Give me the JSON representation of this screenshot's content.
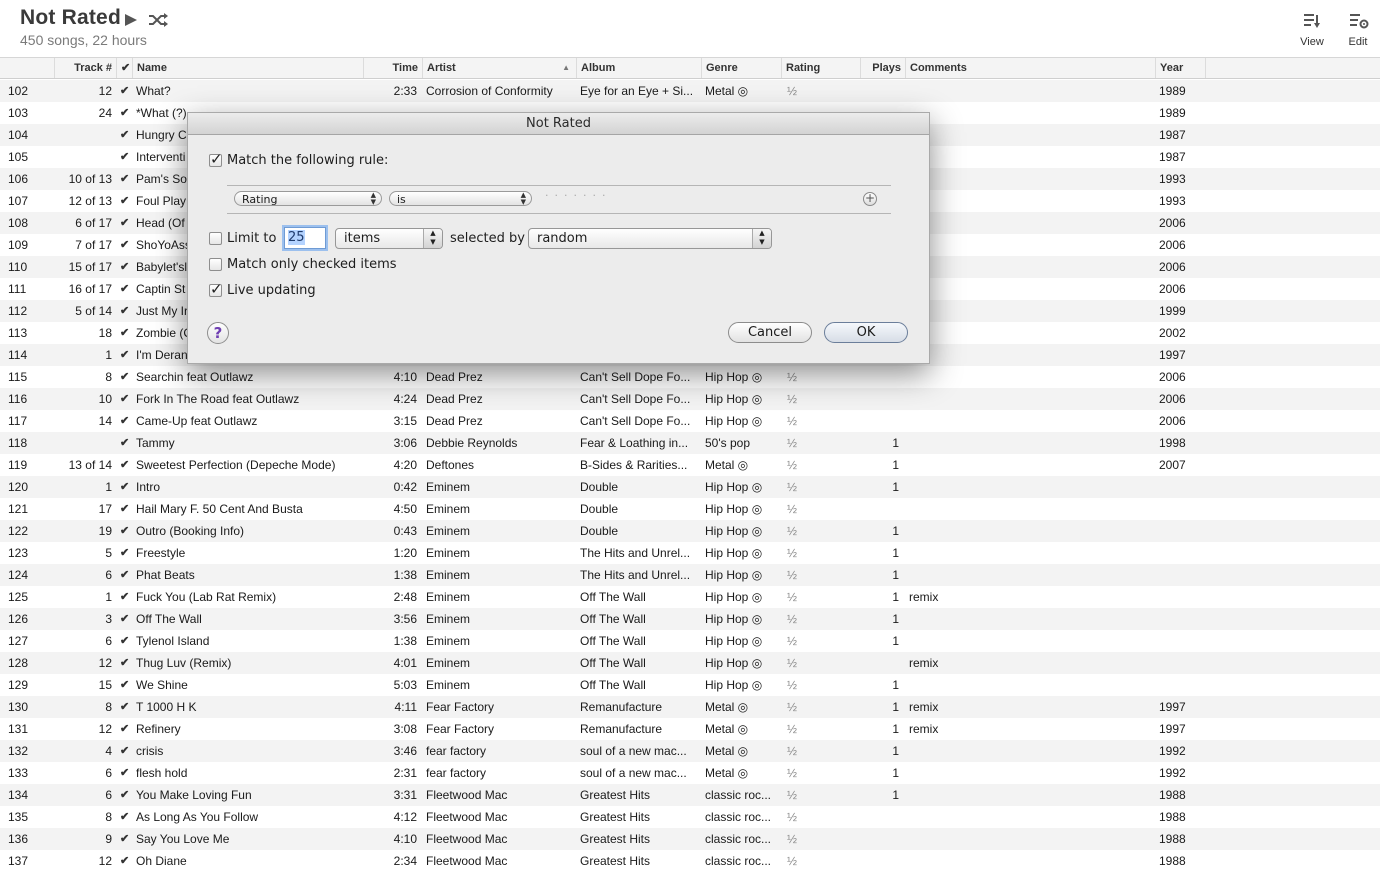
{
  "header": {
    "title": "Not Rated",
    "subtitle": "450 songs, 22 hours",
    "view_label": "View",
    "edit_label": "Edit"
  },
  "columns": {
    "track": "Track #",
    "check": "✔",
    "name": "Name",
    "time": "Time",
    "artist": "Artist",
    "album": "Album",
    "genre": "Genre",
    "rating": "Rating",
    "plays": "Plays",
    "comments": "Comments",
    "year": "Year"
  },
  "rows": [
    {
      "num": "102",
      "track": "12",
      "chk": "✔",
      "name": "What?",
      "time": "2:33",
      "artist": "Corrosion of Conformity",
      "album": "Eye for an Eye + Si...",
      "genre": "Metal ◎",
      "rating": "½",
      "plays": "",
      "comments": "",
      "year": "1989"
    },
    {
      "num": "103",
      "track": "24",
      "chk": "✔",
      "name": "*What (?)",
      "time": "",
      "artist": "",
      "album": "",
      "genre": "",
      "rating": "",
      "plays": "",
      "comments": "",
      "year": "1989"
    },
    {
      "num": "104",
      "track": "",
      "chk": "✔",
      "name": "Hungry C",
      "time": "",
      "artist": "",
      "album": "",
      "genre": "",
      "rating": "",
      "plays": "",
      "comments": "",
      "year": "1987"
    },
    {
      "num": "105",
      "track": "",
      "chk": "✔",
      "name": "Interventi",
      "time": "",
      "artist": "",
      "album": "",
      "genre": "",
      "rating": "",
      "plays": "",
      "comments": "",
      "year": "1987"
    },
    {
      "num": "106",
      "track": "10 of 13",
      "chk": "✔",
      "name": "Pam's So",
      "time": "",
      "artist": "",
      "album": "",
      "genre": "",
      "rating": "",
      "plays": "",
      "comments": "",
      "year": "1993"
    },
    {
      "num": "107",
      "track": "12 of 13",
      "chk": "✔",
      "name": "Foul Play",
      "time": "",
      "artist": "",
      "album": "",
      "genre": "",
      "rating": "",
      "plays": "",
      "comments": "",
      "year": "1993"
    },
    {
      "num": "108",
      "track": "6 of 17",
      "chk": "✔",
      "name": "Head (Of",
      "time": "",
      "artist": "",
      "album": "",
      "genre": "",
      "rating": "",
      "plays": "",
      "comments": "",
      "year": "2006"
    },
    {
      "num": "109",
      "track": "7 of 17",
      "chk": "✔",
      "name": "ShoYoAss",
      "time": "",
      "artist": "",
      "album": "",
      "genre": "",
      "rating": "",
      "plays": "",
      "comments": "",
      "year": "2006"
    },
    {
      "num": "110",
      "track": "15 of 17",
      "chk": "✔",
      "name": "Babylet'sl",
      "time": "",
      "artist": "",
      "album": "",
      "genre": "",
      "rating": "",
      "plays": "",
      "comments": "",
      "year": "2006"
    },
    {
      "num": "111",
      "track": "16 of 17",
      "chk": "✔",
      "name": "Captin St",
      "time": "",
      "artist": "",
      "album": "",
      "genre": "",
      "rating": "",
      "plays": "",
      "comments": "",
      "year": "2006"
    },
    {
      "num": "112",
      "track": "5 of 14",
      "chk": "✔",
      "name": "Just My Ir",
      "time": "",
      "artist": "",
      "album": "",
      "genre": "",
      "rating": "",
      "plays": "",
      "comments": "",
      "year": "1999"
    },
    {
      "num": "113",
      "track": "18",
      "chk": "✔",
      "name": "Zombie (C",
      "time": "",
      "artist": "",
      "album": "",
      "genre": "",
      "rating": "",
      "plays": "",
      "comments": "",
      "year": "2002"
    },
    {
      "num": "114",
      "track": "1",
      "chk": "✔",
      "name": "I'm Deran",
      "time": "",
      "artist": "",
      "album": "",
      "genre": "",
      "rating": "",
      "plays": "",
      "comments": "",
      "year": "1997"
    },
    {
      "num": "115",
      "track": "8",
      "chk": "✔",
      "name": "Searchin feat Outlawz",
      "time": "4:10",
      "artist": "Dead Prez",
      "album": "Can't Sell Dope Fo...",
      "genre": "Hip Hop ◎",
      "rating": "½",
      "plays": "",
      "comments": "",
      "year": "2006"
    },
    {
      "num": "116",
      "track": "10",
      "chk": "✔",
      "name": "Fork In The Road feat Outlawz",
      "time": "4:24",
      "artist": "Dead Prez",
      "album": "Can't Sell Dope Fo...",
      "genre": "Hip Hop ◎",
      "rating": "½",
      "plays": "",
      "comments": "",
      "year": "2006"
    },
    {
      "num": "117",
      "track": "14",
      "chk": "✔",
      "name": "Came-Up feat Outlawz",
      "time": "3:15",
      "artist": "Dead Prez",
      "album": "Can't Sell Dope Fo...",
      "genre": "Hip Hop ◎",
      "rating": "½",
      "plays": "",
      "comments": "",
      "year": "2006"
    },
    {
      "num": "118",
      "track": "",
      "chk": "✔",
      "name": "Tammy",
      "time": "3:06",
      "artist": "Debbie Reynolds",
      "album": "Fear & Loathing in...",
      "genre": "50's pop",
      "rating": "½",
      "plays": "1",
      "comments": "",
      "year": "1998"
    },
    {
      "num": "119",
      "track": "13 of 14",
      "chk": "✔",
      "name": "Sweetest Perfection (Depeche Mode)",
      "time": "4:20",
      "artist": "Deftones",
      "album": "B-Sides & Rarities...",
      "genre": "Metal ◎",
      "rating": "½",
      "plays": "1",
      "comments": "",
      "year": "2007"
    },
    {
      "num": "120",
      "track": "1",
      "chk": "✔",
      "name": "Intro",
      "time": "0:42",
      "artist": "Eminem",
      "album": "Double",
      "genre": "Hip Hop ◎",
      "rating": "½",
      "plays": "1",
      "comments": "",
      "year": ""
    },
    {
      "num": "121",
      "track": "17",
      "chk": "✔",
      "name": "Hail Mary F. 50 Cent And Busta",
      "time": "4:50",
      "artist": "Eminem",
      "album": "Double",
      "genre": "Hip Hop ◎",
      "rating": "½",
      "plays": "",
      "comments": "",
      "year": ""
    },
    {
      "num": "122",
      "track": "19",
      "chk": "✔",
      "name": "Outro (Booking Info)",
      "time": "0:43",
      "artist": "Eminem",
      "album": "Double",
      "genre": "Hip Hop ◎",
      "rating": "½",
      "plays": "1",
      "comments": "",
      "year": ""
    },
    {
      "num": "123",
      "track": "5",
      "chk": "✔",
      "name": "Freestyle",
      "time": "1:20",
      "artist": "Eminem",
      "album": "The Hits and Unrel...",
      "genre": "Hip Hop ◎",
      "rating": "½",
      "plays": "1",
      "comments": "",
      "year": ""
    },
    {
      "num": "124",
      "track": "6",
      "chk": "✔",
      "name": "Phat Beats",
      "time": "1:38",
      "artist": "Eminem",
      "album": "The Hits and Unrel...",
      "genre": "Hip Hop ◎",
      "rating": "½",
      "plays": "1",
      "comments": "",
      "year": ""
    },
    {
      "num": "125",
      "track": "1",
      "chk": "✔",
      "name": "Fuck You (Lab Rat Remix)",
      "time": "2:48",
      "artist": "Eminem",
      "album": "Off The Wall",
      "genre": "Hip Hop ◎",
      "rating": "½",
      "plays": "1",
      "comments": "remix",
      "year": ""
    },
    {
      "num": "126",
      "track": "3",
      "chk": "✔",
      "name": "Off The Wall",
      "time": "3:56",
      "artist": "Eminem",
      "album": "Off The Wall",
      "genre": "Hip Hop ◎",
      "rating": "½",
      "plays": "1",
      "comments": "",
      "year": ""
    },
    {
      "num": "127",
      "track": "6",
      "chk": "✔",
      "name": "Tylenol Island",
      "time": "1:38",
      "artist": "Eminem",
      "album": "Off The Wall",
      "genre": "Hip Hop ◎",
      "rating": "½",
      "plays": "1",
      "comments": "",
      "year": ""
    },
    {
      "num": "128",
      "track": "12",
      "chk": "✔",
      "name": "Thug Luv (Remix)",
      "time": "4:01",
      "artist": "Eminem",
      "album": "Off The Wall",
      "genre": "Hip Hop ◎",
      "rating": "½",
      "plays": "",
      "comments": "remix",
      "year": ""
    },
    {
      "num": "129",
      "track": "15",
      "chk": "✔",
      "name": "We Shine",
      "time": "5:03",
      "artist": "Eminem",
      "album": "Off The Wall",
      "genre": "Hip Hop ◎",
      "rating": "½",
      "plays": "1",
      "comments": "",
      "year": ""
    },
    {
      "num": "130",
      "track": "8",
      "chk": "✔",
      "name": "T 1000 H K",
      "time": "4:11",
      "artist": "Fear Factory",
      "album": "Remanufacture",
      "genre": "Metal ◎",
      "rating": "½",
      "plays": "1",
      "comments": "remix",
      "year": "1997"
    },
    {
      "num": "131",
      "track": "12",
      "chk": "✔",
      "name": "Refinery",
      "time": "3:08",
      "artist": "Fear Factory",
      "album": "Remanufacture",
      "genre": "Metal ◎",
      "rating": "½",
      "plays": "1",
      "comments": "remix",
      "year": "1997"
    },
    {
      "num": "132",
      "track": "4",
      "chk": "✔",
      "name": "crisis",
      "time": "3:46",
      "artist": "fear factory",
      "album": "soul of a new mac...",
      "genre": "Metal ◎",
      "rating": "½",
      "plays": "1",
      "comments": "",
      "year": "1992"
    },
    {
      "num": "133",
      "track": "6",
      "chk": "✔",
      "name": "flesh hold",
      "time": "2:31",
      "artist": "fear factory",
      "album": "soul of a new mac...",
      "genre": "Metal ◎",
      "rating": "½",
      "plays": "1",
      "comments": "",
      "year": "1992"
    },
    {
      "num": "134",
      "track": "6",
      "chk": "✔",
      "name": "You Make Loving Fun",
      "time": "3:31",
      "artist": "Fleetwood Mac",
      "album": "Greatest Hits",
      "genre": "classic roc...",
      "rating": "½",
      "plays": "1",
      "comments": "",
      "year": "1988"
    },
    {
      "num": "135",
      "track": "8",
      "chk": "✔",
      "name": "As Long As You Follow",
      "time": "4:12",
      "artist": "Fleetwood Mac",
      "album": "Greatest Hits",
      "genre": "classic roc...",
      "rating": "½",
      "plays": "",
      "comments": "",
      "year": "1988"
    },
    {
      "num": "136",
      "track": "9",
      "chk": "✔",
      "name": "Say You Love Me",
      "time": "4:10",
      "artist": "Fleetwood Mac",
      "album": "Greatest Hits",
      "genre": "classic roc...",
      "rating": "½",
      "plays": "",
      "comments": "",
      "year": "1988"
    },
    {
      "num": "137",
      "track": "12",
      "chk": "✔",
      "name": "Oh Diane",
      "time": "2:34",
      "artist": "Fleetwood Mac",
      "album": "Greatest Hits",
      "genre": "classic roc...",
      "rating": "½",
      "plays": "",
      "comments": "",
      "year": "1988"
    }
  ],
  "dialog": {
    "title": "Not Rated",
    "match_rule_label": "Match the following rule:",
    "match_rule_checked": true,
    "rule_field": "Rating",
    "rule_operator": "is",
    "limit_label": "Limit to",
    "limit_checked": false,
    "limit_value": "25",
    "limit_unit": "items",
    "selected_by_label": "selected by",
    "selected_by_value": "random",
    "match_checked_label": "Match only checked items",
    "match_checked_checked": false,
    "live_updating_label": "Live updating",
    "live_updating_checked": true,
    "help_label": "?",
    "cancel_label": "Cancel",
    "ok_label": "OK"
  }
}
